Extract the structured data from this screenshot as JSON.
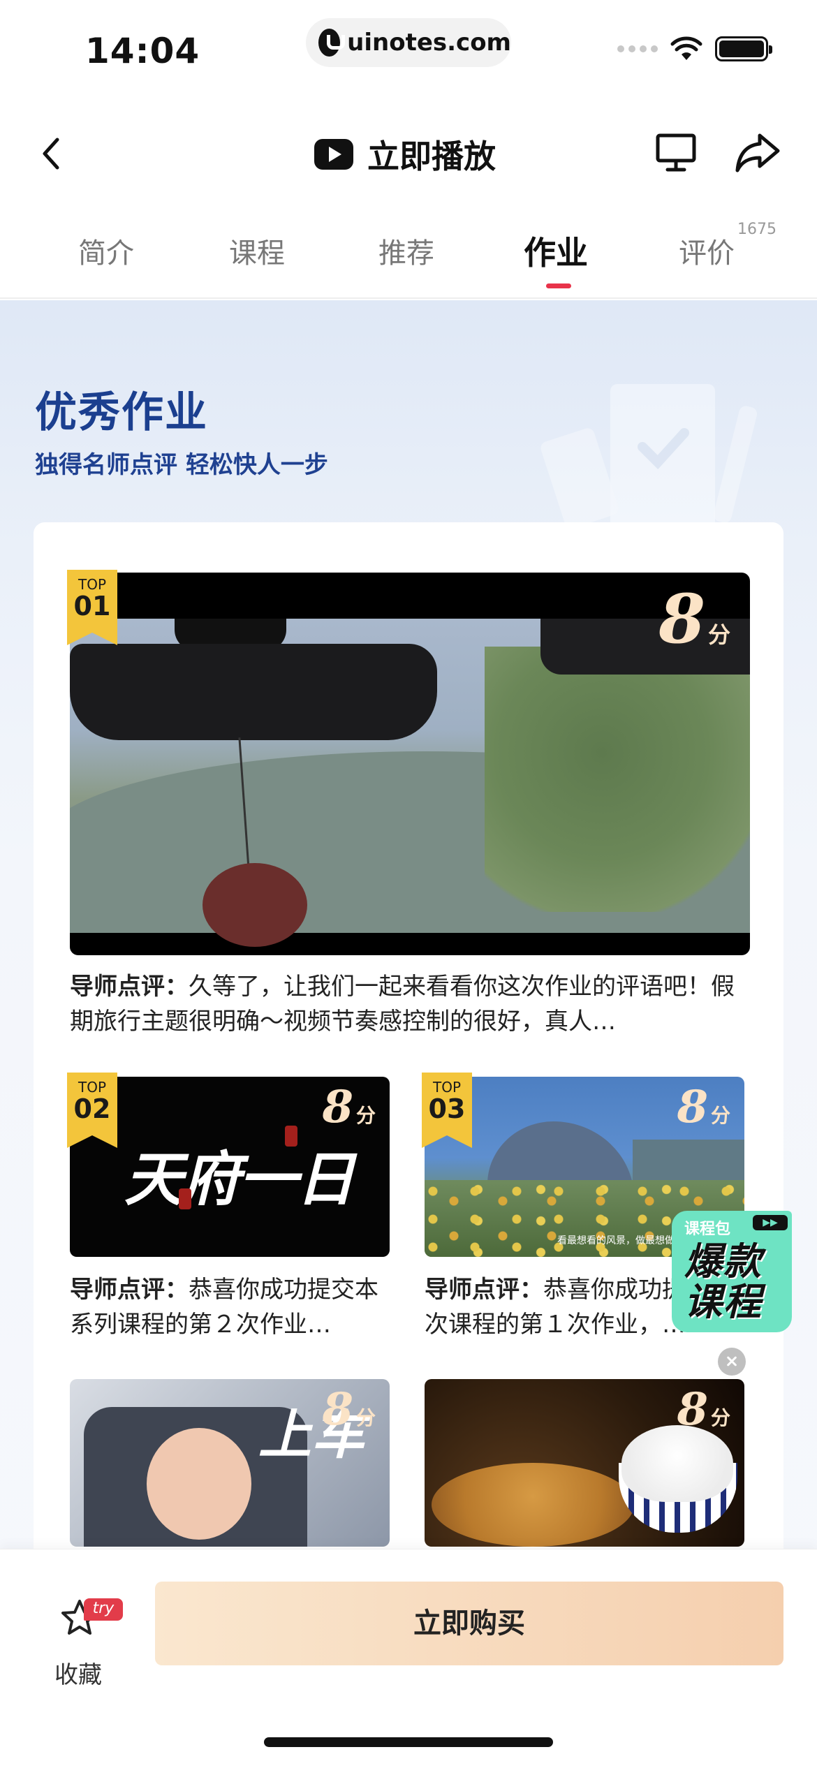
{
  "status_bar": {
    "time": "14:04",
    "url": "uinotes.com"
  },
  "nav": {
    "title": "立即播放",
    "icons": [
      "back-icon",
      "play-icon",
      "tv-icon",
      "share-icon"
    ]
  },
  "tabs": {
    "items": [
      {
        "label": "简介",
        "active": false
      },
      {
        "label": "课程",
        "active": false
      },
      {
        "label": "推荐",
        "active": false
      },
      {
        "label": "作业",
        "active": true
      },
      {
        "label": "评价",
        "active": false
      }
    ],
    "review_count": "1675",
    "active_color": "#e8334a"
  },
  "hero": {
    "title": "优秀作业",
    "subtitle": "独得名师点评 轻松快人一步"
  },
  "works": [
    {
      "rank_prefix": "TOP",
      "rank": "01",
      "score": "8",
      "score_unit": "分",
      "review_label": "导师点评：",
      "review_text": "久等了，让我们一起来看看你这次作业的评语吧！假期旅行主题很明确～视频节奏感控制的很好，真人…"
    },
    {
      "rank_prefix": "TOP",
      "rank": "02",
      "score": "8",
      "score_unit": "分",
      "thumb_text": "天府一日",
      "review_label": "导师点评：",
      "review_text": "恭喜你成功提交本系列课程的第２次作业…"
    },
    {
      "rank_prefix": "TOP",
      "rank": "03",
      "score": "8",
      "score_unit": "分",
      "thumb_caption": "看最想看的风景，做最想做的",
      "review_label": "导师点评：",
      "review_text": "恭喜你成功提交本次课程的第１次作业，…"
    },
    {
      "score": "8",
      "score_unit": "分",
      "thumb_text": "上车"
    },
    {
      "score": "8",
      "score_unit": "分"
    }
  ],
  "float_badge": {
    "tag": "课程包",
    "line1": "爆款",
    "line2": "课程",
    "arrows": "▶▶"
  },
  "bottom_bar": {
    "favorite_label": "收藏",
    "try_badge": "try",
    "buy_label": "立即购买"
  },
  "colors": {
    "brand_blue": "#1b3f8f",
    "badge_yellow": "#f3c53b",
    "try_red": "#e23c4a",
    "float_green": "#6ee3c3"
  }
}
